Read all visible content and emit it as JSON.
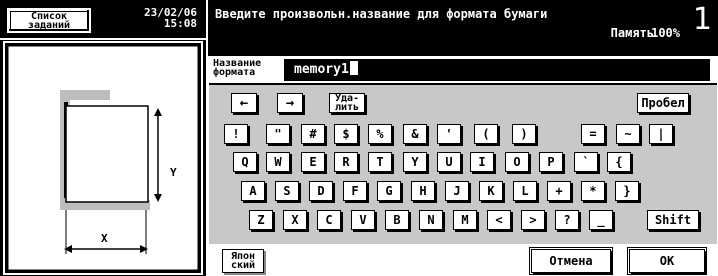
{
  "header": {
    "job_list_label": "Список\nзаданий",
    "date": "23/02/06",
    "time": "15:08",
    "date_time": "23/02/06\n15:08"
  },
  "message": {
    "text": "Введите произвольн.название для формата бумаги",
    "memory_label": "Память",
    "memory_value": "100%",
    "page_number": "1"
  },
  "diagram": {
    "x_label": "X",
    "y_label": "Y"
  },
  "name_field": {
    "label": "Название\nформата",
    "value": "memory1"
  },
  "keyboard": {
    "left_arrow": "←",
    "right_arrow": "→",
    "delete_label": "Уда-\nлить",
    "space_label": "Пробел",
    "row1": [
      "!",
      "\"",
      "#",
      "$",
      "%",
      "&",
      "'",
      "(",
      ")",
      "=",
      "~",
      "|"
    ],
    "row2": [
      "Q",
      "W",
      "E",
      "R",
      "T",
      "Y",
      "U",
      "I",
      "O",
      "P",
      "`",
      "{"
    ],
    "row3": [
      "A",
      "S",
      "D",
      "F",
      "G",
      "H",
      "J",
      "K",
      "L",
      "+",
      "*",
      "}"
    ],
    "row4": [
      "Z",
      "X",
      "C",
      "V",
      "B",
      "N",
      "M",
      "<",
      ">",
      "?",
      "_"
    ],
    "shift_label": "Shift"
  },
  "footer": {
    "japanese_label": "Япон\nский",
    "cancel_label": "Отмена",
    "ok_label": "OK"
  }
}
